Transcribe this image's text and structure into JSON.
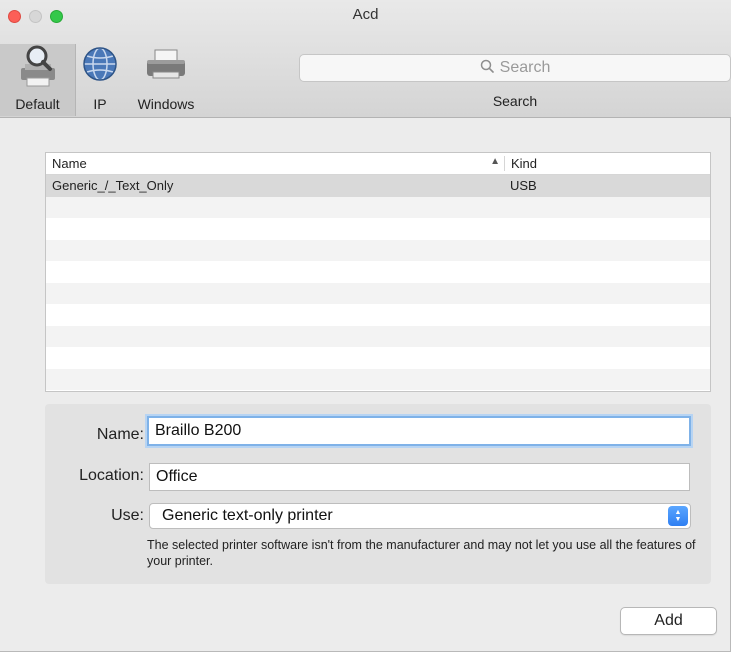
{
  "window": {
    "title": "Acd"
  },
  "toolbar": {
    "tools": [
      {
        "label": "Default",
        "icon": "printer-search-icon"
      },
      {
        "label": "IP",
        "icon": "globe-icon"
      },
      {
        "label": "Windows",
        "icon": "windows-printer-icon"
      }
    ],
    "search": {
      "placeholder": "Search",
      "label": "Search"
    }
  },
  "printer_list": {
    "columns": {
      "name": "Name",
      "kind": "Kind"
    },
    "rows": [
      {
        "name": "Generic_/_Text_Only",
        "kind": "USB"
      }
    ]
  },
  "details": {
    "name_label": "Name:",
    "name_value": "Braillo B200",
    "location_label": "Location:",
    "location_value": "Office",
    "use_label": "Use:",
    "use_value": "Generic text-only printer",
    "note": "The selected printer software isn't from the manufacturer and may not let you use all the features of your printer."
  },
  "buttons": {
    "add": "Add"
  },
  "colors": {
    "close": "#fc5f57",
    "minimize": "#d7d7d7",
    "zoom": "#34c84a",
    "focus_ring": "#7fb2e8",
    "stepper": "#2f7ff2"
  }
}
